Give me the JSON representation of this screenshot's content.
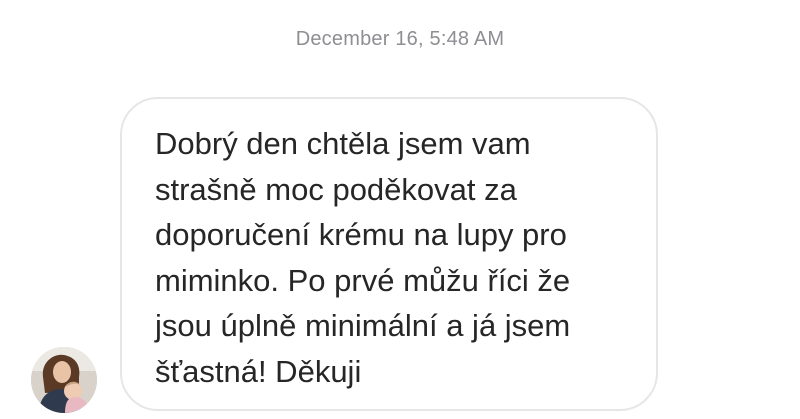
{
  "conversation": {
    "timestamp": "December 16, 5:48 AM",
    "messages": [
      {
        "direction": "incoming",
        "sender_avatar_icon": "user-avatar-photo",
        "text": "Dobrý den chtěla jsem vam\nstrašně moc poděkovat za\ndoporučení krému na lupy pro\nmiminko. Po prvé můžu říci že\njsou úplně minimální a já jsem\nšťastná! Děkuji"
      }
    ]
  },
  "colors": {
    "timestamp_text": "#8e8e93",
    "bubble_border": "#e6e6e6",
    "message_text": "#262626",
    "background": "#ffffff"
  }
}
